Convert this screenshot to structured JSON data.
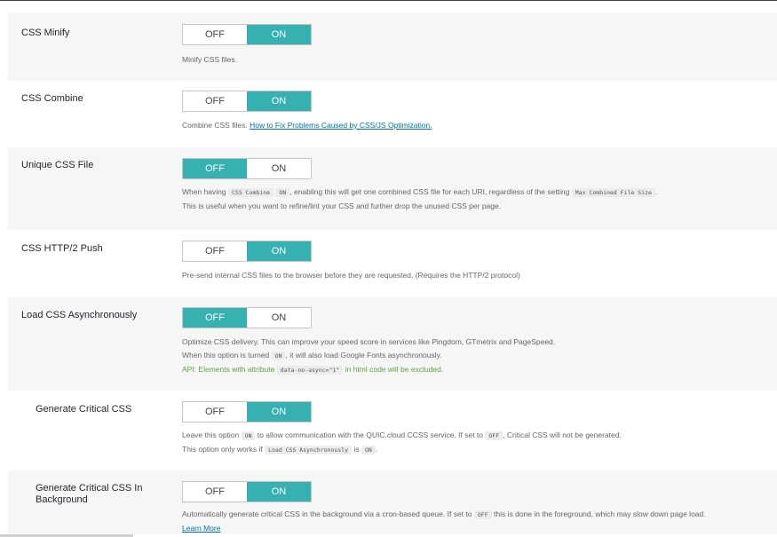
{
  "settings": [
    {
      "label": "CSS Minify",
      "off": "OFF",
      "on": "ON",
      "state": "on",
      "desc": {
        "text": "Minify CSS files."
      }
    },
    {
      "label": "CSS Combine",
      "off": "OFF",
      "on": "ON",
      "state": "on",
      "desc": {
        "text": "Combine CSS files.",
        "link": "How to Fix Problems Caused by CSS/JS Optimization."
      }
    },
    {
      "label": "Unique CSS File",
      "off": "OFF",
      "on": "ON",
      "state": "off",
      "desc": {
        "l1a": "When having",
        "code1": "CSS Combine",
        "code2": "ON",
        "l1b": ", enabling this will get one combined CSS file for each URI, regardless of the setting",
        "code3": "Max Combined File Size",
        "l1c": ".",
        "l2": "This is useful when you want to refine/lint your CSS and further drop the unused CSS per page."
      }
    },
    {
      "label": "CSS HTTP/2 Push",
      "off": "OFF",
      "on": "ON",
      "state": "on",
      "desc": {
        "text": "Pre-send internal CSS files to the browser before they are requested. (Requires the HTTP/2 protocol)"
      }
    },
    {
      "label": "Load CSS Asynchronously",
      "off": "OFF",
      "on": "ON",
      "state": "off",
      "desc": {
        "l1": "Optimize CSS delivery. This can improve your speed score in services like Pingdom, GTmetrix and PageSpeed.",
        "l2a": "When this option is turned",
        "code1": "ON",
        "l2b": ", it will also load Google Fonts asynchronously.",
        "l3a": "API: Elements with attribute",
        "code2": "data-no-async=\"1\"",
        "l3b": "in html code will be excluded."
      }
    },
    {
      "label": "Generate Critical CSS",
      "off": "OFF",
      "on": "ON",
      "state": "on",
      "desc": {
        "l1a": "Leave this option",
        "code1": "ON",
        "l1b": "to allow communication with the QUIC.cloud CCSS service. If set to",
        "code2": "OFF",
        "l1c": ", Critical CSS will not be generated.",
        "l2a": "This option only works if",
        "code3": "Load CSS Asynchronously",
        "l2b": "is",
        "code4": "ON",
        "l2c": "."
      }
    },
    {
      "label": "Generate Critical CSS In Background",
      "off": "OFF",
      "on": "ON",
      "state": "on",
      "desc": {
        "l1a": "Automatically generate critical CSS in the background via a cron-based queue. If set to",
        "code1": "OFF",
        "l1b": "this is done in the foreground, which may slow down page load.",
        "link": "Learn More"
      }
    }
  ],
  "colors": {
    "active": "#36b0b0",
    "shade": "#f6f6f6",
    "link": "#0073aa",
    "api_green": "#5aa53b"
  }
}
